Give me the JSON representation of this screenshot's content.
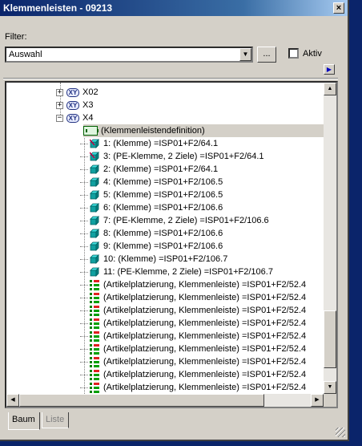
{
  "window": {
    "title": "Klemmenleisten - 09213",
    "close_symbol": "×"
  },
  "filter": {
    "label": "Filter:",
    "selected": "Auswahl",
    "dropdown_arrow": "▼",
    "browse_label": "...",
    "aktiv_label": "Aktiv",
    "aktiv_checked": false,
    "nav_arrow": "▶"
  },
  "tree": {
    "groups": [
      {
        "expander": "+",
        "icon_text": "XY",
        "label": "X02"
      },
      {
        "expander": "+",
        "icon_text": "XY",
        "label": "X3"
      },
      {
        "expander": "−",
        "icon_text": "XY",
        "label": "X4"
      }
    ],
    "definition_label": "(Klemmenleistendefinition)",
    "items": [
      {
        "label": "1: (Klemme) =ISP01+F2/64.1",
        "type": "cube",
        "marked": true
      },
      {
        "label": "3: (PE-Klemme, 2 Ziele) =ISP01+F2/64.1",
        "type": "cube",
        "marked": true
      },
      {
        "label": "2: (Klemme) =ISP01+F2/64.1",
        "type": "cube"
      },
      {
        "label": "4: (Klemme) =ISP01+F2/106.5",
        "type": "cube"
      },
      {
        "label": "5: (Klemme) =ISP01+F2/106.5",
        "type": "cube"
      },
      {
        "label": "6: (Klemme) =ISP01+F2/106.6",
        "type": "cube"
      },
      {
        "label": "7: (PE-Klemme, 2 Ziele) =ISP01+F2/106.6",
        "type": "cube"
      },
      {
        "label": "8: (Klemme) =ISP01+F2/106.6",
        "type": "cube"
      },
      {
        "label": "9: (Klemme) =ISP01+F2/106.6",
        "type": "cube"
      },
      {
        "label": "10: (Klemme) =ISP01+F2/106.7",
        "type": "cube"
      },
      {
        "label": "11: (PE-Klemme, 2 Ziele) =ISP01+F2/106.7",
        "type": "cube"
      },
      {
        "label": "(Artikelplatzierung, Klemmenleiste) =ISP01+F2/52.4",
        "type": "place"
      },
      {
        "label": "(Artikelplatzierung, Klemmenleiste) =ISP01+F2/52.4",
        "type": "place"
      },
      {
        "label": "(Artikelplatzierung, Klemmenleiste) =ISP01+F2/52.4",
        "type": "place"
      },
      {
        "label": "(Artikelplatzierung, Klemmenleiste) =ISP01+F2/52.4",
        "type": "place"
      },
      {
        "label": "(Artikelplatzierung, Klemmenleiste) =ISP01+F2/52.4",
        "type": "place"
      },
      {
        "label": "(Artikelplatzierung, Klemmenleiste) =ISP01+F2/52.4",
        "type": "place"
      },
      {
        "label": "(Artikelplatzierung, Klemmenleiste) =ISP01+F2/52.4",
        "type": "place"
      },
      {
        "label": "(Artikelplatzierung, Klemmenleiste) =ISP01+F2/52.4",
        "type": "place"
      },
      {
        "label": "(Artikelplatzierung, Klemmenleiste) =ISP01+F2/52.4",
        "type": "place"
      },
      {
        "label": "(Artikelplatzierung, Klemmenleiste) =ISP01+F2/52.4",
        "type": "place"
      }
    ]
  },
  "scrollbars": {
    "up": "▲",
    "down": "▼",
    "left": "◀",
    "right": "▶"
  },
  "tabs": [
    {
      "label": "Baum",
      "active": true
    },
    {
      "label": "Liste",
      "active": false
    }
  ],
  "colors": {
    "cube": "#10a0a0",
    "cube_top": "#40e0e0",
    "mark": "#c00040"
  }
}
